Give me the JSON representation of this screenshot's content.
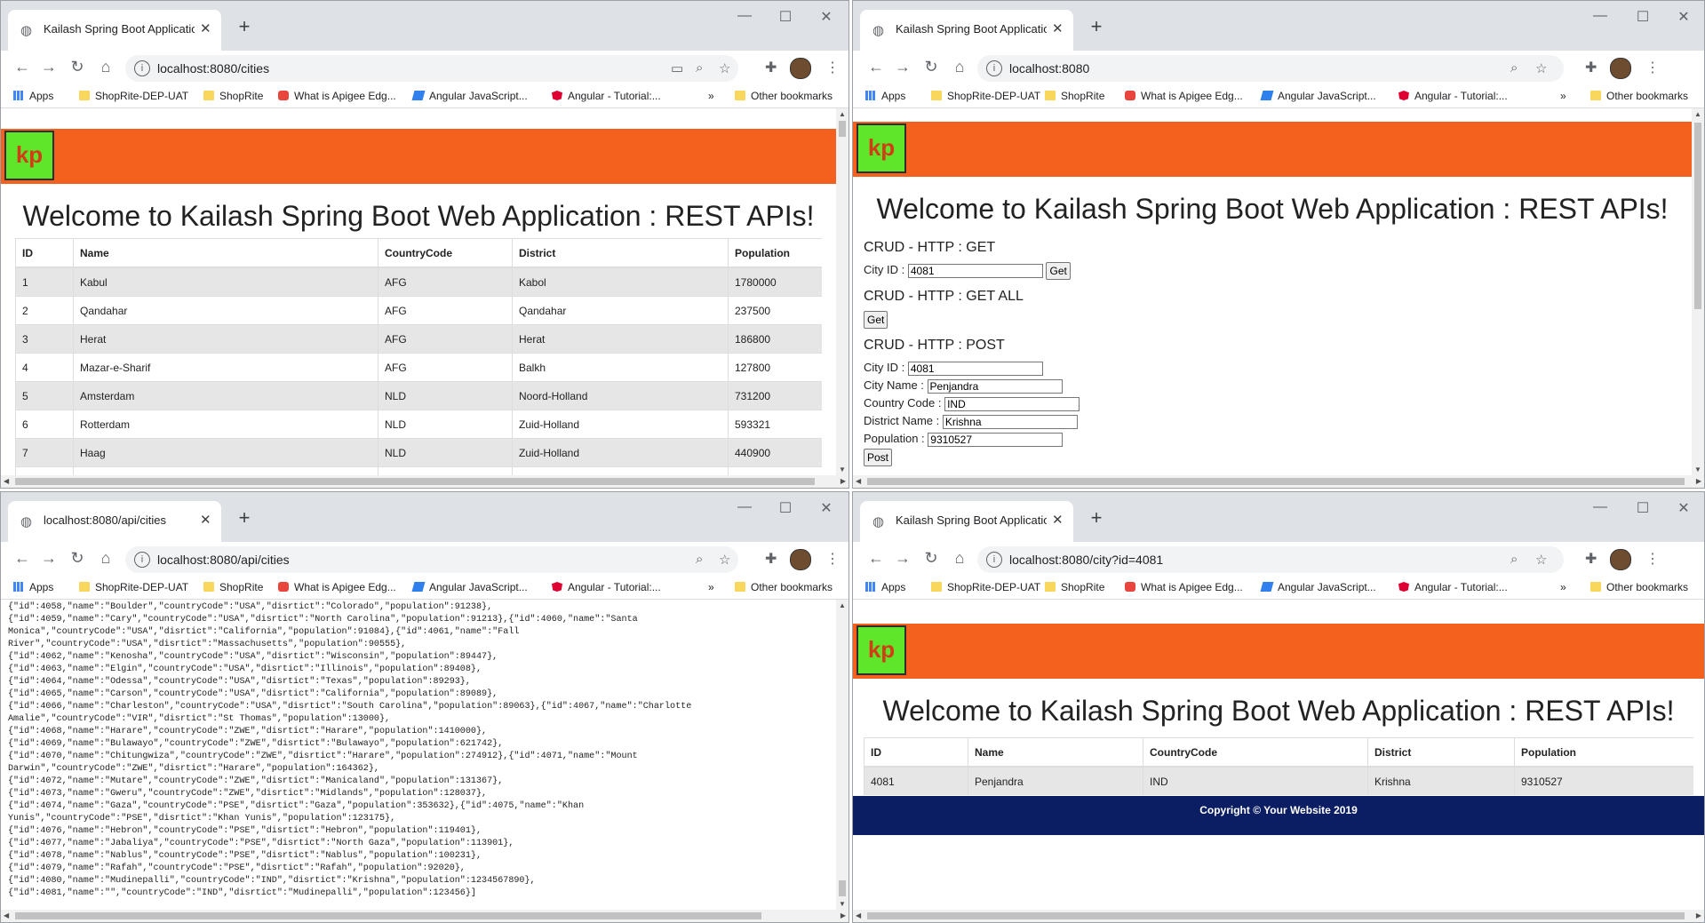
{
  "colors": {
    "banner": "#f4611f",
    "logo_bg": "#5fe62a",
    "logo_text": "#d23c16",
    "footer": "#0b1e64"
  },
  "bookmarks": [
    "Apps",
    "ShopRite-DEP-UAT",
    "ShopRite",
    "What is Apigee Edg...",
    "Angular JavaScript...",
    "Angular - Tutorial:..."
  ],
  "more_bookmarks": "»",
  "other_bookmarks": "Other bookmarks",
  "logo_text": "kp",
  "welcome": "Welcome to Kailash Spring Boot Web Application : REST APIs!",
  "win1": {
    "tab_title": "Kailash Spring Boot Application",
    "url": "localhost:8080/cities",
    "table": {
      "headers": [
        "ID",
        "Name",
        "CountryCode",
        "District",
        "Population"
      ],
      "rows": [
        [
          "1",
          "Kabul",
          "AFG",
          "Kabol",
          "1780000"
        ],
        [
          "2",
          "Qandahar",
          "AFG",
          "Qandahar",
          "237500"
        ],
        [
          "3",
          "Herat",
          "AFG",
          "Herat",
          "186800"
        ],
        [
          "4",
          "Mazar-e-Sharif",
          "AFG",
          "Balkh",
          "127800"
        ],
        [
          "5",
          "Amsterdam",
          "NLD",
          "Noord-Holland",
          "731200"
        ],
        [
          "6",
          "Rotterdam",
          "NLD",
          "Zuid-Holland",
          "593321"
        ],
        [
          "7",
          "Haag",
          "NLD",
          "Zuid-Holland",
          "440900"
        ]
      ]
    }
  },
  "win2": {
    "tab_title": "Kailash Spring Boot Application",
    "url": "localhost:8080",
    "get": {
      "heading": "CRUD - HTTP : GET",
      "id_label": "City ID :",
      "id_value": "4081",
      "button": "Get"
    },
    "get_all": {
      "heading": "CRUD - HTTP : GET ALL",
      "button": "Get"
    },
    "post": {
      "heading": "CRUD - HTTP : POST",
      "id_label": "City ID :",
      "id_value": "4081",
      "name_label": "City Name :",
      "name_value": "Penjandra",
      "cc_label": "Country Code :",
      "cc_value": "IND",
      "district_label": "District Name :",
      "district_value": "Krishna",
      "pop_label": "Population :",
      "pop_value": "9310527",
      "button": "Post"
    }
  },
  "win3": {
    "tab_title": "localhost:8080/api/cities",
    "url": "localhost:8080/api/cities",
    "json_lines": [
      "{\"id\":4058,\"name\":\"Boulder\",\"countryCode\":\"USA\",\"disrtict\":\"Colorado\",\"population\":91238},",
      "{\"id\":4059,\"name\":\"Cary\",\"countryCode\":\"USA\",\"disrtict\":\"North Carolina\",\"population\":91213},{\"id\":4060,\"name\":\"Santa",
      "Monica\",\"countryCode\":\"USA\",\"disrtict\":\"California\",\"population\":91084},{\"id\":4061,\"name\":\"Fall",
      "River\",\"countryCode\":\"USA\",\"disrtict\":\"Massachusetts\",\"population\":90555},",
      "{\"id\":4062,\"name\":\"Kenosha\",\"countryCode\":\"USA\",\"disrtict\":\"Wisconsin\",\"population\":89447},",
      "{\"id\":4063,\"name\":\"Elgin\",\"countryCode\":\"USA\",\"disrtict\":\"Illinois\",\"population\":89408},",
      "{\"id\":4064,\"name\":\"Odessa\",\"countryCode\":\"USA\",\"disrtict\":\"Texas\",\"population\":89293},",
      "{\"id\":4065,\"name\":\"Carson\",\"countryCode\":\"USA\",\"disrtict\":\"California\",\"population\":89089},",
      "{\"id\":4066,\"name\":\"Charleston\",\"countryCode\":\"USA\",\"disrtict\":\"South Carolina\",\"population\":89063},{\"id\":4067,\"name\":\"Charlotte",
      "Amalie\",\"countryCode\":\"VIR\",\"disrtict\":\"St Thomas\",\"population\":13000},",
      "{\"id\":4068,\"name\":\"Harare\",\"countryCode\":\"ZWE\",\"disrtict\":\"Harare\",\"population\":1410000},",
      "{\"id\":4069,\"name\":\"Bulawayo\",\"countryCode\":\"ZWE\",\"disrtict\":\"Bulawayo\",\"population\":621742},",
      "{\"id\":4070,\"name\":\"Chitungwiza\",\"countryCode\":\"ZWE\",\"disrtict\":\"Harare\",\"population\":274912},{\"id\":4071,\"name\":\"Mount",
      "Darwin\",\"countryCode\":\"ZWE\",\"disrtict\":\"Harare\",\"population\":164362},",
      "{\"id\":4072,\"name\":\"Mutare\",\"countryCode\":\"ZWE\",\"disrtict\":\"Manicaland\",\"population\":131367},",
      "{\"id\":4073,\"name\":\"Gweru\",\"countryCode\":\"ZWE\",\"disrtict\":\"Midlands\",\"population\":128037},",
      "{\"id\":4074,\"name\":\"Gaza\",\"countryCode\":\"PSE\",\"disrtict\":\"Gaza\",\"population\":353632},{\"id\":4075,\"name\":\"Khan",
      "Yunis\",\"countryCode\":\"PSE\",\"disrtict\":\"Khan Yunis\",\"population\":123175},",
      "{\"id\":4076,\"name\":\"Hebron\",\"countryCode\":\"PSE\",\"disrtict\":\"Hebron\",\"population\":119401},",
      "{\"id\":4077,\"name\":\"Jabaliya\",\"countryCode\":\"PSE\",\"disrtict\":\"North Gaza\",\"population\":113901},",
      "{\"id\":4078,\"name\":\"Nablus\",\"countryCode\":\"PSE\",\"disrtict\":\"Nablus\",\"population\":100231},",
      "{\"id\":4079,\"name\":\"Rafah\",\"countryCode\":\"PSE\",\"disrtict\":\"Rafah\",\"population\":92020},",
      "{\"id\":4080,\"name\":\"Mudinepalli\",\"countryCode\":\"IND\",\"disrtict\":\"Krishna\",\"population\":1234567890},",
      "{\"id\":4081,\"name\":\"\",\"countryCode\":\"IND\",\"disrtict\":\"Mudinepalli\",\"population\":123456}]"
    ]
  },
  "win4": {
    "tab_title": "Kailash Spring Boot Application",
    "url": "localhost:8080/city?id=4081",
    "table": {
      "headers": [
        "ID",
        "Name",
        "CountryCode",
        "District",
        "Population"
      ],
      "rows": [
        [
          "4081",
          "Penjandra",
          "IND",
          "Krishna",
          "9310527"
        ]
      ]
    },
    "footer": "Copyright © Your Website 2019"
  }
}
